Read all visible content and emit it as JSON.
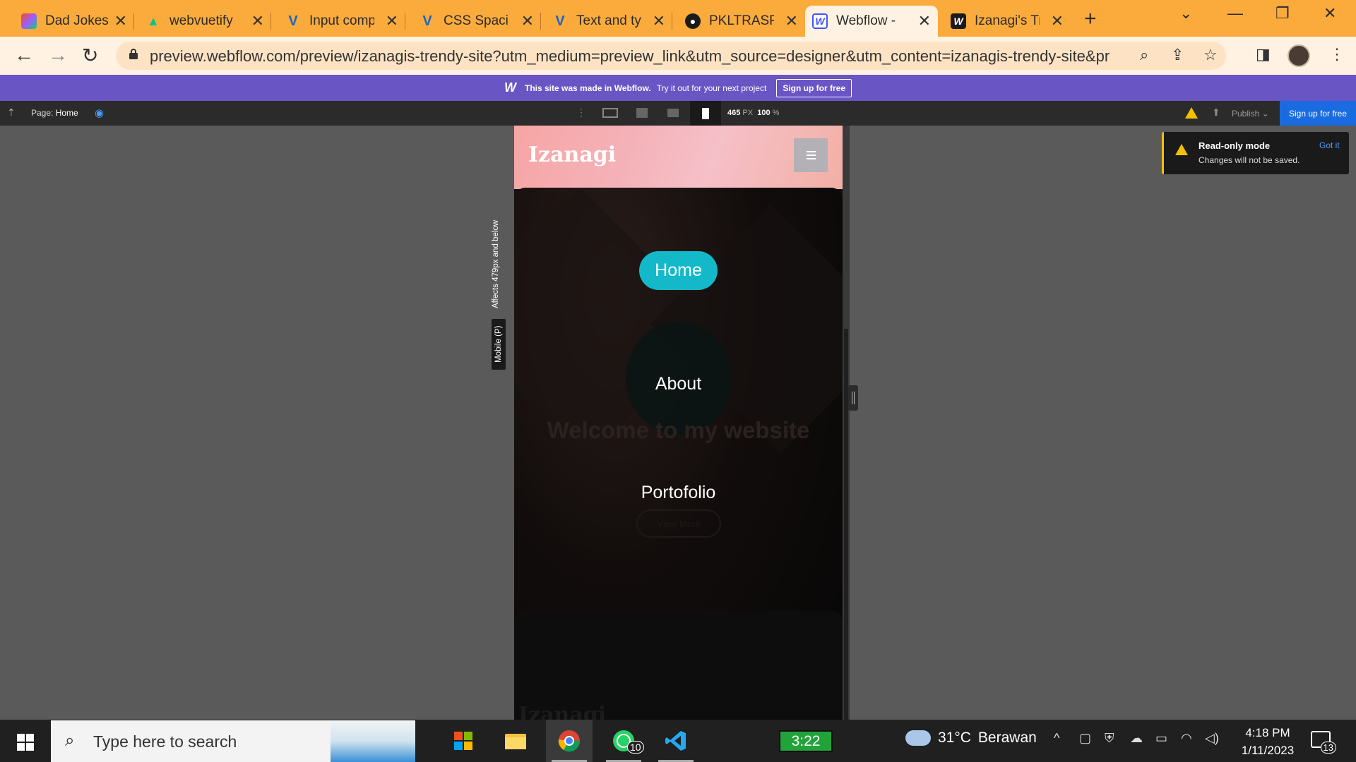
{
  "browser": {
    "tabs": [
      {
        "label": "Dad Jokes - ",
        "icon": "figma-icon",
        "color": "#e94f37"
      },
      {
        "label": "webvuetify",
        "icon": "nuxt-icon",
        "color": "#00c58e"
      },
      {
        "label": "Input comp",
        "icon": "vuetify-icon",
        "color": "#1867c0"
      },
      {
        "label": "CSS Spacin",
        "icon": "vuetify-icon",
        "color": "#1867c0"
      },
      {
        "label": "Text and ty",
        "icon": "vuetify-icon",
        "color": "#1867c0"
      },
      {
        "label": "PKLTRASPA",
        "icon": "github-icon",
        "color": "#1b1b1b"
      },
      {
        "label": "Webflow - ",
        "icon": "webflow-icon",
        "color": "#4353ff"
      },
      {
        "label": "Izanagi's Tr",
        "icon": "webflow-icon",
        "color": "#1b1b1b"
      }
    ],
    "active_tab_index": 6,
    "url": "preview.webflow.com/preview/izanagis-trendy-site?utm_medium=preview_link&utm_source=designer&utm_content=izanagis-trendy-site&preview..."
  },
  "webflow_banner": {
    "made_in": "This site was made in Webflow.",
    "try_it": "Try it out for your next project",
    "signup": "Sign up for free"
  },
  "designer": {
    "page_label": "Page:",
    "page_name": "Home",
    "width_value": "465",
    "width_unit": "PX",
    "zoom_value": "100",
    "zoom_unit": "%",
    "publish": "Publish",
    "signup": "Sign up for free",
    "breakpoint_affects": "Affects 479px and below",
    "breakpoint_mode": "Mobile (P)"
  },
  "toast": {
    "title": "Read-only mode",
    "subtitle": "Changes will not be saved.",
    "dismiss": "Got it"
  },
  "site": {
    "brand": "Izanagi",
    "hero_title": "Welcome to my website",
    "hero_button": "View More",
    "footer_brand": "Izanagi",
    "nav": [
      "Home",
      "About",
      "Portofolio"
    ],
    "accent": "#14b9c9",
    "header_gradient": "#f6b4b8"
  },
  "taskbar": {
    "search_placeholder": "Type here to search",
    "battery_time": "3:22",
    "whatsapp_badge": "10",
    "temperature": "31°C",
    "weather": "Berawan",
    "time": "4:18 PM",
    "date": "1/11/2023",
    "notifications": "13"
  }
}
